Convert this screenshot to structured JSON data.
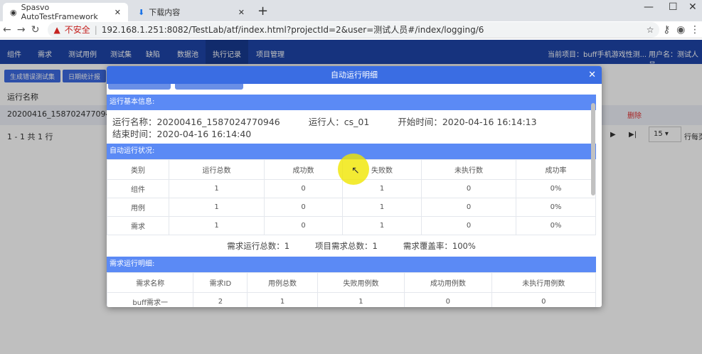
{
  "browser": {
    "tabs": [
      {
        "title": "Spasvo AutoTestFramework",
        "icon": "app-icon"
      },
      {
        "title": "下载内容",
        "icon": "download-icon"
      }
    ],
    "security": "不安全",
    "url": "192.168.1.251:8082/TestLab/atf/index.html?projectId=2&user=测试人员#/index/logging/6"
  },
  "nav": {
    "items": [
      "组件",
      "需求",
      "测试用例",
      "测试集",
      "缺陷",
      "数据池",
      "执行记录",
      "项目管理"
    ],
    "active": "执行记录",
    "project": "当前项目：buff手机游戏性测...",
    "user": "用户名：测试人员"
  },
  "page": {
    "buttons": [
      "生成错误测试集",
      "日期统计报"
    ],
    "column": "运行名称",
    "row_name": "20200416_1587024770946",
    "row_action": "删除",
    "pagination": "1 - 1 共 1 行",
    "page_size": "15",
    "per_page": "行每页"
  },
  "modal": {
    "title": "自动运行明细",
    "basic_header": "运行基本信息:",
    "basic": {
      "name": "运行名称：20200416_1587024770946",
      "runner": "运行人：cs_01",
      "start": "开始时间：2020-04-16 16:14:13",
      "end": "结束时间：2020-04-16 16:14:40"
    },
    "status_header": "自动运行状况:",
    "status_columns": [
      "类别",
      "运行总数",
      "成功数",
      "失败数",
      "未执行数",
      "成功率"
    ],
    "status_rows": [
      [
        "组件",
        "1",
        "0",
        "1",
        "0",
        "0%"
      ],
      [
        "用例",
        "1",
        "0",
        "1",
        "0",
        "0%"
      ],
      [
        "需求",
        "1",
        "0",
        "1",
        "0",
        "0%"
      ]
    ],
    "summary": [
      "需求运行总数：1",
      "项目需求总数：1",
      "需求覆盖率：100%"
    ],
    "req_header": "需求运行明细:",
    "req_columns": [
      "需求名称",
      "需求ID",
      "用例总数",
      "失败用例数",
      "成功用例数",
      "未执行用例数"
    ],
    "req_rows": [
      [
        "buff需求一",
        "2",
        "1",
        "1",
        "0",
        "0"
      ]
    ]
  }
}
